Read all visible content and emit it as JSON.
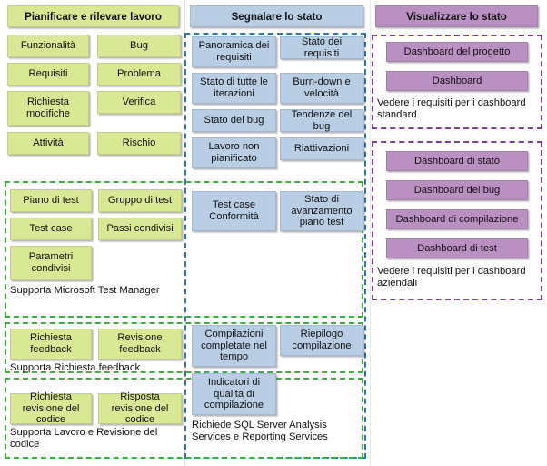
{
  "diagram": {
    "title": "Pianificare e rilevare lavoro / Segnalare lo stato / Visualizzare lo stato",
    "colors": {
      "green_fill": "#d9e894",
      "blue_fill": "#b9cde5",
      "purple_fill": "#ba8fc1",
      "green_border": "#3fae3f",
      "blue_border": "#2e75b6",
      "purple_border": "#7d3f98"
    }
  },
  "columns": {
    "plan": {
      "header": "Pianificare e rilevare lavoro",
      "groups": [
        {
          "id": "work-items",
          "boxed": false,
          "items": [
            "Funzionalità",
            "Bug",
            "Requisiti",
            "Problema",
            "Richiesta modifiche",
            "Verifica",
            "Attività",
            "Rischio"
          ]
        },
        {
          "id": "test-artifacts",
          "boxed": true,
          "items": [
            "Piano di test",
            "Gruppo di test",
            "Test case",
            "Passi condivisi",
            "Parametri condivisi"
          ],
          "note": "Supporta Microsoft Test Manager"
        },
        {
          "id": "feedback",
          "boxed": true,
          "items": [
            "Richiesta feedback",
            "Revisione feedback"
          ],
          "note": "Supporta Richiesta feedback"
        },
        {
          "id": "code-review",
          "boxed": true,
          "items": [
            "Richiesta revisione del codice",
            "Risposta revisione del codice"
          ],
          "note": "Supporta Lavoro e Revisione del codice"
        }
      ]
    },
    "report": {
      "header": "Segnalare lo stato",
      "groups": [
        {
          "id": "status-reports",
          "items": [
            "Panoramica dei requisiti",
            "Stato dei requisiti",
            "Stato di tutte le iterazioni",
            "Burn-down e velocità",
            "Stato del bug",
            "Tendenze del bug",
            "Lavoro non pianificato",
            "Riattivazioni"
          ]
        },
        {
          "id": "test-reports",
          "items": [
            "Test case Conformità",
            "Stato di avanzamento piano test"
          ]
        },
        {
          "id": "build-reports",
          "items": [
            "Compilazioni completate nel tempo",
            "Riepilogo compilazione",
            "Indicatori di qualità di compilazione"
          ],
          "note": "Richiede SQL Server Analysis Services e Reporting Services"
        }
      ]
    },
    "visualize": {
      "header": "Visualizzare lo stato",
      "groups": [
        {
          "id": "standard-dashboards",
          "items": [
            "Dashboard del progetto",
            "Dashboard"
          ],
          "note": "Vedere i requisiti per i dashboard standard"
        },
        {
          "id": "enterprise-dashboards",
          "items": [
            "Dashboard di stato",
            "Dashboard dei bug",
            "Dashboard di compilazione",
            "Dashboard di test"
          ],
          "note": "Vedere i requisiti per i dashboard aziendali"
        }
      ]
    }
  }
}
